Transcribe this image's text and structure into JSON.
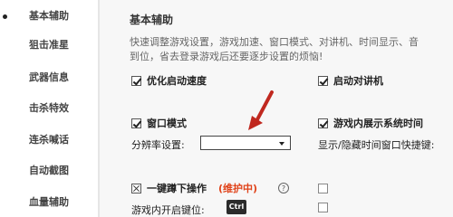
{
  "sidebar": {
    "items": [
      {
        "label": "基本辅助"
      },
      {
        "label": "狙击准星"
      },
      {
        "label": "武器信息"
      },
      {
        "label": "击杀特效"
      },
      {
        "label": "连杀喊话"
      },
      {
        "label": "自动截图"
      },
      {
        "label": "血量辅助"
      }
    ]
  },
  "main": {
    "title": "基本辅助",
    "description_line1": "快速调整游戏设置，游戏加速、窗口模式、对讲机、时间显示、音",
    "description_line2": "到位，省去登录游戏后还要逐步设置的烦恼!",
    "options": {
      "optimize_launch": "优化启动速度",
      "launch_intercom": "启动对讲机",
      "window_mode": "窗口模式",
      "show_system_time": "游戏内展示系统时间",
      "resolution_label": "分辨率设置:",
      "resolution_value": "",
      "toggle_time_hotkey_label": "显示/隐藏时间窗口快捷键:",
      "one_key_crouch": "一键蹲下操作",
      "maintenance_tag": "(维护中)",
      "help_glyph": "?",
      "crouch_key_label": "游戏内开启键位:",
      "crouch_key_value": "Ctrl"
    }
  },
  "colors": {
    "maintenance": "#e0431a",
    "arrow": "#c0281f"
  }
}
